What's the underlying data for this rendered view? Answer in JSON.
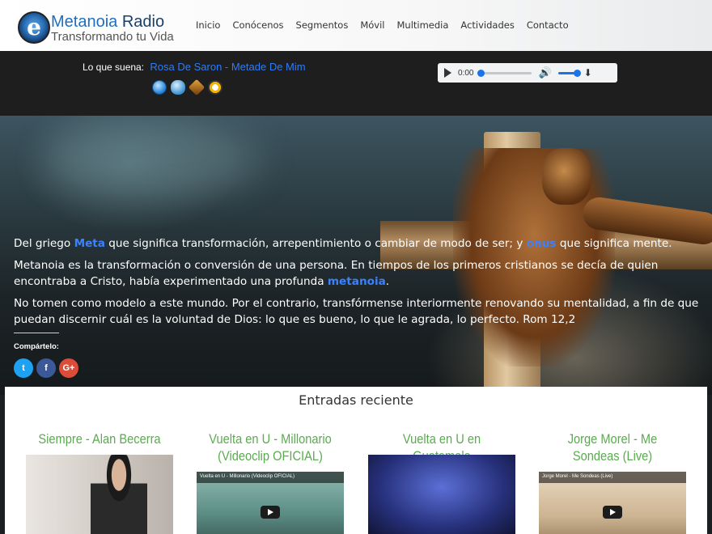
{
  "header": {
    "brand_name_1": "Metanoia",
    "brand_name_2": "Radio",
    "tagline": "Transformando tu Vida",
    "logo_letter": "e",
    "nav": [
      "Inicio",
      "Conócenos",
      "Segmentos",
      "Móvil",
      "Multimedia",
      "Actividades",
      "Contacto"
    ]
  },
  "player": {
    "now_label": "Lo que suena:",
    "song": "Rosa De Saron - Metade De Mim",
    "time": "0:00",
    "share_icons": [
      "itunes-icon",
      "chat-icon",
      "winamp-icon",
      "vlc-icon"
    ],
    "control_buttons": [
      "play-button",
      "pause-button",
      "volume-up-button",
      "volume-down-button"
    ]
  },
  "hero": {
    "p1_a": "Del griego ",
    "p1_meta": "Meta",
    "p1_b": " que significa transformación, arrepentimiento o cambiar de modo de ser; y ",
    "p1_onus": "onus",
    "p1_c": " que significa mente.",
    "p2_a": "Metanoia es la transformación o conversión de una persona. En tiempos de los primeros cristianos se decía de quien encontraba a Cristo, había experimentado una profunda ",
    "p2_metanoia": "metanoia",
    "p2_b": ".",
    "p3": "No tomen como modelo a este mundo. Por el contrario, transfórmense interiormente renovando su mentalidad, a fin de que puedan discernir cuál es la voluntad de Dios: lo que es bueno, lo que le agrada, lo perfecto. Rom 12,2",
    "share_label": "Compártelo:",
    "social": {
      "twitter": "t",
      "facebook": "f",
      "google": "G+"
    }
  },
  "recent": {
    "title": "Entradas reciente",
    "cards": [
      {
        "title": "Siempre - Alan Becerra",
        "video_label": ""
      },
      {
        "title": "Vuelta en U - Millonario (Videoclip OFICIAL)",
        "video_label": "Vuelta en U - Millonario (Videoclip OFICIAL)"
      },
      {
        "title": "Vuelta en U en Guatemala",
        "video_label": ""
      },
      {
        "title": "Jorge Morel - Me Sondeas (Live)",
        "video_label": "Jorge Morel - Me Sondeas (Live)"
      }
    ]
  },
  "colors": {
    "accent_blue": "#2e7cf6",
    "green": "#5aab4f",
    "player_bg": "#1e1e1e"
  }
}
